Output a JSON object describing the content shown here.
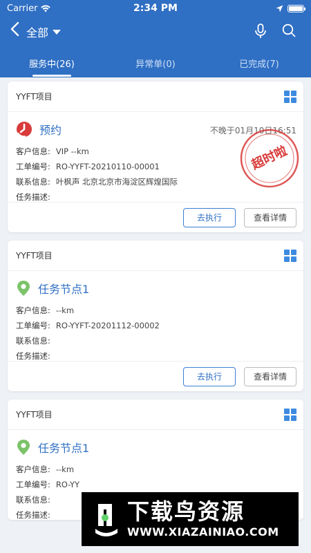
{
  "status_bar": {
    "carrier": "Carrier",
    "time": "2:34 PM"
  },
  "navbar": {
    "title": "全部",
    "icons": [
      "back-chevron-icon",
      "caret-down-icon",
      "microphone-icon",
      "search-icon"
    ]
  },
  "tabs": [
    {
      "label": "服务中(26)",
      "active": true
    },
    {
      "label": "异常单(0)",
      "active": false
    },
    {
      "label": "已完成(7)",
      "active": false
    }
  ],
  "cards": [
    {
      "project": "YYFT项目",
      "title": "预约",
      "icon": "clock-icon",
      "deadline": "不晚于01月10日16:51",
      "stamp_text": "超时啦",
      "customer_label": "客户信息:",
      "customer_value": "VIP --km",
      "order_label": "工单编号:",
      "order_value": "RO-YYFT-20210110-00001",
      "contact_label": "联系信息:",
      "contact_value": "叶枫声  北京北京市海淀区辉煌国际",
      "desc_label": "任务描述:",
      "desc_value": "",
      "execute_label": "去执行",
      "details_label": "查看详情"
    },
    {
      "project": "YYFT项目",
      "title": "任务节点1",
      "icon": "location-pin-icon",
      "customer_label": "客户信息:",
      "customer_value": "--km",
      "order_label": "工单编号:",
      "order_value": "RO-YYFT-20201112-00002",
      "contact_label": "联系信息:",
      "contact_value": "",
      "desc_label": "任务描述:",
      "desc_value": "",
      "execute_label": "去执行",
      "details_label": "查看详情"
    },
    {
      "project": "YYFT项目",
      "title": "任务节点1",
      "icon": "location-pin-icon",
      "customer_label": "客户信息:",
      "customer_value": "--km",
      "order_label": "工单编号:",
      "order_value": "RO-YY",
      "contact_label": "联系信息:",
      "contact_value": "",
      "desc_label": "任务描述:",
      "desc_value": ""
    }
  ],
  "watermark": {
    "main": "下载鸟资源",
    "url": "WWW.XIAZAINIAO.COM"
  },
  "colors": {
    "primary": "#2f6fc4",
    "accent_red": "#d93a3a",
    "pin_green": "#7cc36a"
  }
}
